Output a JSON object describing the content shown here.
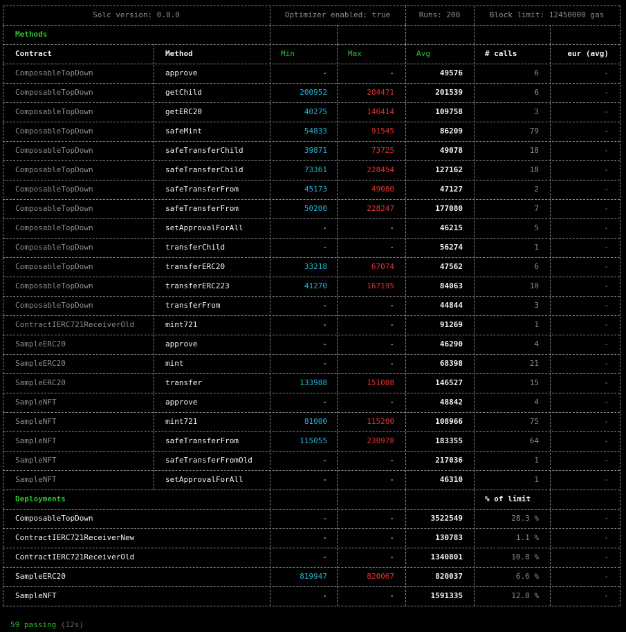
{
  "colors": {
    "background": "#000000",
    "green": "#2fbf2f",
    "min": "#26b3d3",
    "max": "#e0332f",
    "text": "#f2f2f2",
    "muted": "#8d8d8d"
  },
  "header": {
    "solc": "Solc version: 0.8.0",
    "optimizer": "Optimizer enabled: true",
    "runs": "Runs: 200",
    "block_limit": "Block limit: 12450000 gas"
  },
  "methods": {
    "title": "Methods",
    "columns": [
      "Contract",
      "Method",
      "Min",
      "Max",
      "Avg",
      "# calls",
      "eur (avg)"
    ],
    "rows": [
      {
        "contract": "ComposableTopDown",
        "method": "approve",
        "min": "-",
        "max": "-",
        "avg": "49576",
        "calls": "6",
        "eur": "-",
        "contract_style": "gray"
      },
      {
        "contract": "ComposableTopDown",
        "method": "getChild",
        "min": "200952",
        "max": "204471",
        "avg": "201539",
        "calls": "6",
        "eur": "-",
        "contract_style": "gray"
      },
      {
        "contract": "ComposableTopDown",
        "method": "getERC20",
        "min": "40275",
        "max": "146414",
        "avg": "109758",
        "calls": "3",
        "eur": "-",
        "contract_style": "gray"
      },
      {
        "contract": "ComposableTopDown",
        "method": "safeMint",
        "min": "54833",
        "max": "91545",
        "avg": "86209",
        "calls": "79",
        "eur": "-",
        "contract_style": "gray"
      },
      {
        "contract": "ComposableTopDown",
        "method": "safeTransferChild",
        "min": "39871",
        "max": "73725",
        "avg": "49078",
        "calls": "18",
        "eur": "-",
        "contract_style": "gray"
      },
      {
        "contract": "ComposableTopDown",
        "method": "safeTransferChild",
        "min": "73361",
        "max": "228454",
        "avg": "127162",
        "calls": "18",
        "eur": "-",
        "contract_style": "gray"
      },
      {
        "contract": "ComposableTopDown",
        "method": "safeTransferFrom",
        "min": "45173",
        "max": "49080",
        "avg": "47127",
        "calls": "2",
        "eur": "-",
        "contract_style": "gray"
      },
      {
        "contract": "ComposableTopDown",
        "method": "safeTransferFrom",
        "min": "50200",
        "max": "228247",
        "avg": "177080",
        "calls": "7",
        "eur": "-",
        "contract_style": "gray"
      },
      {
        "contract": "ComposableTopDown",
        "method": "setApprovalForAll",
        "min": "-",
        "max": "-",
        "avg": "46215",
        "calls": "5",
        "eur": "-",
        "contract_style": "gray"
      },
      {
        "contract": "ComposableTopDown",
        "method": "transferChild",
        "min": "-",
        "max": "-",
        "avg": "56274",
        "calls": "1",
        "eur": "-",
        "contract_style": "gray"
      },
      {
        "contract": "ComposableTopDown",
        "method": "transferERC20",
        "min": "33218",
        "max": "67074",
        "avg": "47562",
        "calls": "6",
        "eur": "-",
        "contract_style": "gray"
      },
      {
        "contract": "ComposableTopDown",
        "method": "transferERC223",
        "min": "41270",
        "max": "167195",
        "avg": "84063",
        "calls": "10",
        "eur": "-",
        "contract_style": "gray"
      },
      {
        "contract": "ComposableTopDown",
        "method": "transferFrom",
        "min": "-",
        "max": "-",
        "avg": "44844",
        "calls": "3",
        "eur": "-",
        "contract_style": "gray"
      },
      {
        "contract": "ContractIERC721ReceiverOld",
        "method": "mint721",
        "min": "-",
        "max": "-",
        "avg": "91269",
        "calls": "1",
        "eur": "-",
        "contract_style": "gray"
      },
      {
        "contract": "SampleERC20",
        "method": "approve",
        "min": "-",
        "max": "-",
        "avg": "46290",
        "calls": "4",
        "eur": "-",
        "contract_style": "gray"
      },
      {
        "contract": "SampleERC20",
        "method": "mint",
        "min": "-",
        "max": "-",
        "avg": "68398",
        "calls": "21",
        "eur": "-",
        "contract_style": "gray"
      },
      {
        "contract": "SampleERC20",
        "method": "transfer",
        "min": "133988",
        "max": "151088",
        "avg": "146527",
        "calls": "15",
        "eur": "-",
        "contract_style": "gray"
      },
      {
        "contract": "SampleNFT",
        "method": "approve",
        "min": "-",
        "max": "-",
        "avg": "48842",
        "calls": "4",
        "eur": "-",
        "contract_style": "gray"
      },
      {
        "contract": "SampleNFT",
        "method": "mint721",
        "min": "81000",
        "max": "115200",
        "avg": "108966",
        "calls": "75",
        "eur": "-",
        "contract_style": "gray"
      },
      {
        "contract": "SampleNFT",
        "method": "safeTransferFrom",
        "min": "115055",
        "max": "230978",
        "avg": "183355",
        "calls": "64",
        "eur": "-",
        "contract_style": "gray"
      },
      {
        "contract": "SampleNFT",
        "method": "safeTransferFromOld",
        "min": "-",
        "max": "-",
        "avg": "217036",
        "calls": "1",
        "eur": "-",
        "contract_style": "gray"
      },
      {
        "contract": "SampleNFT",
        "method": "setApprovalForAll",
        "min": "-",
        "max": "-",
        "avg": "46310",
        "calls": "1",
        "eur": "-",
        "contract_style": "gray"
      }
    ]
  },
  "deployments": {
    "title": "Deployments",
    "limit_header": "% of limit",
    "rows": [
      {
        "contract": "ComposableTopDown",
        "min": "-",
        "max": "-",
        "avg": "3522549",
        "limit": "28.3 %",
        "eur": "-"
      },
      {
        "contract": "ContractIERC721ReceiverNew",
        "min": "-",
        "max": "-",
        "avg": "130783",
        "limit": "1.1 %",
        "eur": "-"
      },
      {
        "contract": "ContractIERC721ReceiverOld",
        "min": "-",
        "max": "-",
        "avg": "1340801",
        "limit": "10.8 %",
        "eur": "-"
      },
      {
        "contract": "SampleERC20",
        "min": "819947",
        "max": "820067",
        "avg": "820037",
        "limit": "6.6 %",
        "eur": "-"
      },
      {
        "contract": "SampleNFT",
        "min": "-",
        "max": "-",
        "avg": "1591335",
        "limit": "12.8 %",
        "eur": "-"
      }
    ]
  },
  "footer": {
    "passing": "59 passing",
    "duration": "(12s)"
  }
}
